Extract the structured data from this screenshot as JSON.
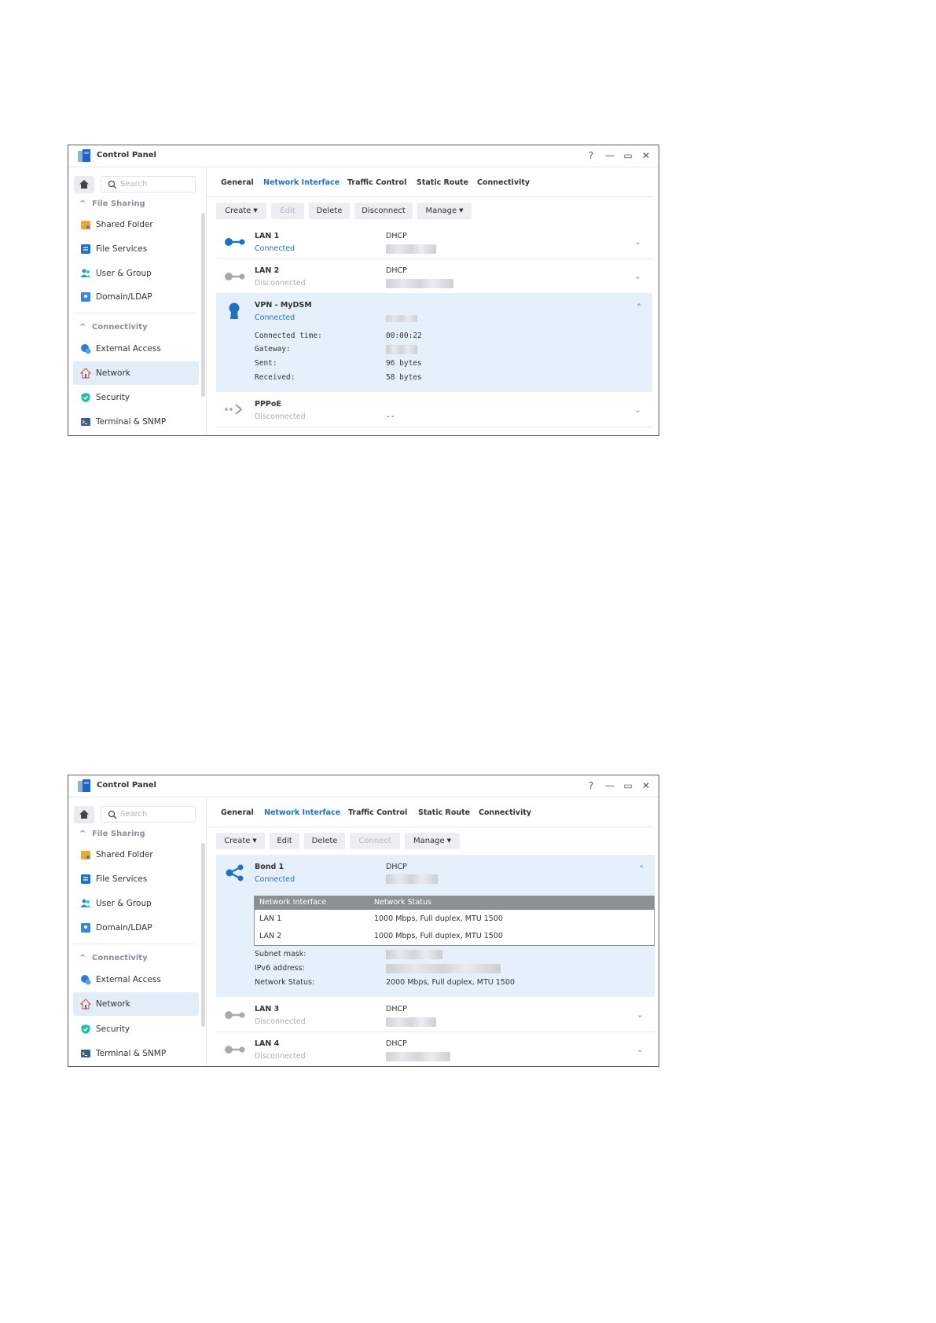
{
  "windows": [
    {
      "title": "Control Panel",
      "search_placeholder": "Search",
      "sidebar": {
        "section1": "File Sharing",
        "items1": [
          "Shared Folder",
          "File Services",
          "User & Group",
          "Domain/LDAP"
        ],
        "section2": "Connectivity",
        "items2": [
          "External Access",
          "Network",
          "Security",
          "Terminal & SNMP"
        ],
        "active": "Network"
      },
      "tabs": [
        "General",
        "Network Interface",
        "Traffic Control",
        "Static Route",
        "Connectivity"
      ],
      "active_tab": "Network Interface",
      "toolbar": [
        {
          "label": "Create",
          "dropdown": true,
          "enabled": true
        },
        {
          "label": "Edit",
          "dropdown": false,
          "enabled": false
        },
        {
          "label": "Delete",
          "dropdown": false,
          "enabled": true
        },
        {
          "label": "Disconnect",
          "dropdown": false,
          "enabled": true
        },
        {
          "label": "Manage",
          "dropdown": true,
          "enabled": true
        }
      ],
      "interfaces": [
        {
          "name": "LAN 1",
          "status": "Connected",
          "connected": true,
          "method": "DHCP",
          "icon": "lan-connected-icon"
        },
        {
          "name": "LAN 2",
          "status": "Disconnected",
          "connected": false,
          "method": "DHCP",
          "icon": "lan-disconnected-icon"
        },
        {
          "name": "VPN - MyDSM",
          "status": "Connected",
          "connected": true,
          "icon": "vpn-icon",
          "expanded": true,
          "details": [
            {
              "label": "Connected time:",
              "value": "00:00:22"
            },
            {
              "label": "Gateway:",
              "value": ""
            },
            {
              "label": "Sent:",
              "value": "96 bytes"
            },
            {
              "label": "Received:",
              "value": "58 bytes"
            }
          ]
        },
        {
          "name": "PPPoE",
          "status": "Disconnected",
          "connected": false,
          "method": "--",
          "icon": "pppoe-icon"
        }
      ]
    },
    {
      "title": "Control Panel",
      "search_placeholder": "Search",
      "sidebar": {
        "section1": "File Sharing",
        "items1": [
          "Shared Folder",
          "File Services",
          "User & Group",
          "Domain/LDAP"
        ],
        "section2": "Connectivity",
        "items2": [
          "External Access",
          "Network",
          "Security",
          "Terminal & SNMP"
        ],
        "active": "Network"
      },
      "tabs": [
        "General",
        "Network Interface",
        "Traffic Control",
        "Static Route",
        "Connectivity"
      ],
      "active_tab": "Network Interface",
      "toolbar": [
        {
          "label": "Create",
          "dropdown": true,
          "enabled": true
        },
        {
          "label": "Edit",
          "dropdown": false,
          "enabled": true
        },
        {
          "label": "Delete",
          "dropdown": false,
          "enabled": true
        },
        {
          "label": "Connect",
          "dropdown": false,
          "enabled": false
        },
        {
          "label": "Manage",
          "dropdown": true,
          "enabled": true
        }
      ],
      "bond": {
        "name": "Bond 1",
        "status": "Connected",
        "method": "DHCP",
        "table_headers": [
          "Network Interface",
          "Network Status"
        ],
        "table_rows": [
          {
            "iface": "LAN 1",
            "status": "1000 Mbps, Full duplex, MTU 1500"
          },
          {
            "iface": "LAN 2",
            "status": "1000 Mbps, Full duplex, MTU 1500"
          }
        ],
        "details": [
          {
            "label": "Subnet mask:",
            "value": ""
          },
          {
            "label": "IPv6 address:",
            "value": ""
          },
          {
            "label": "Network Status:",
            "value": "2000 Mbps, Full duplex, MTU 1500"
          }
        ]
      },
      "interfaces": [
        {
          "name": "LAN 3",
          "status": "Disconnected",
          "method": "DHCP"
        },
        {
          "name": "LAN 4",
          "status": "Disconnected",
          "method": "DHCP"
        }
      ]
    }
  ]
}
